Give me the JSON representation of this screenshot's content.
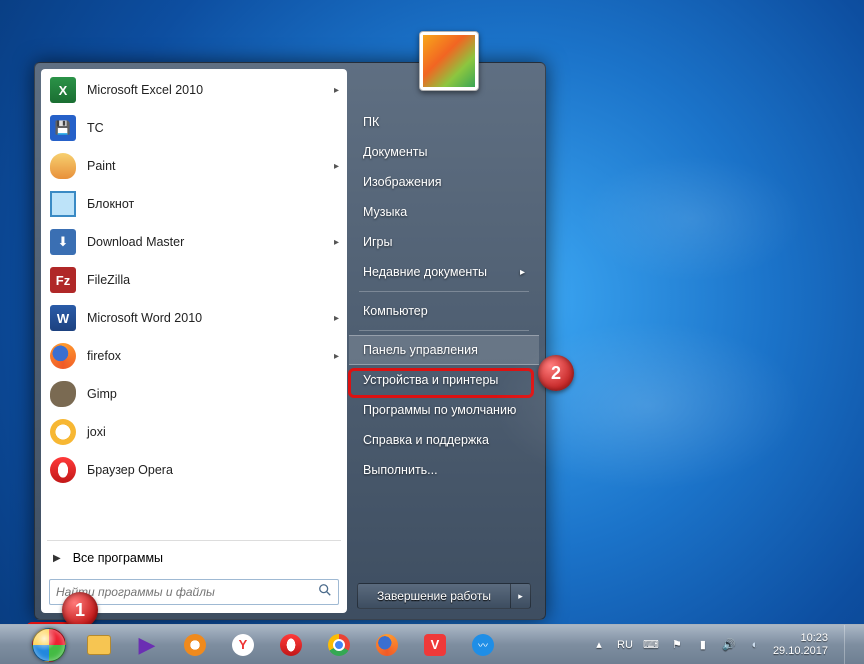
{
  "programs": [
    {
      "label": "Microsoft Excel 2010",
      "icon": "excel-icon",
      "arrow": true
    },
    {
      "label": "TC",
      "icon": "save-icon",
      "arrow": false
    },
    {
      "label": "Paint",
      "icon": "paint-icon",
      "arrow": true
    },
    {
      "label": "Блокнот",
      "icon": "notepad-icon",
      "arrow": false
    },
    {
      "label": "Download Master",
      "icon": "downloadmaster-icon",
      "arrow": true
    },
    {
      "label": "FileZilla",
      "icon": "filezilla-icon",
      "arrow": false
    },
    {
      "label": "Microsoft Word 2010",
      "icon": "word-icon",
      "arrow": true
    },
    {
      "label": "firefox",
      "icon": "firefox-icon",
      "arrow": true
    },
    {
      "label": "Gimp",
      "icon": "gimp-icon",
      "arrow": false
    },
    {
      "label": "joxi",
      "icon": "joxi-icon",
      "arrow": false
    },
    {
      "label": "Браузер Opera",
      "icon": "opera-icon",
      "arrow": false
    }
  ],
  "all_programs_label": "Все программы",
  "search": {
    "placeholder": "Найти программы и файлы"
  },
  "right_panel": {
    "group1": [
      "ПК",
      "Документы",
      "Изображения",
      "Музыка",
      "Игры"
    ],
    "recent": {
      "label": "Недавние документы",
      "arrow": true
    },
    "group2": [
      "Компьютер"
    ],
    "highlighted": "Панель управления",
    "group3": [
      "Устройства и принтеры",
      "Программы по умолчанию",
      "Справка и поддержка",
      "Выполнить..."
    ]
  },
  "shutdown_label": "Завершение работы",
  "taskbar": {
    "apps": [
      {
        "name": "explorer-icon",
        "color": "#f6c552"
      },
      {
        "name": "media-player-icon",
        "color": "#6b2fb3"
      },
      {
        "name": "wmp-icon",
        "color": "#f08a1d"
      },
      {
        "name": "yandex-icon",
        "color": "#ffcc00",
        "text": "Y"
      },
      {
        "name": "opera-icon",
        "color": "#e2231a"
      },
      {
        "name": "chrome-icon",
        "color": "#4285f4"
      },
      {
        "name": "firefox-icon",
        "color": "#ff7a2e"
      },
      {
        "name": "vivaldi-icon",
        "color": "#ef3939",
        "text": "V"
      },
      {
        "name": "maxthon-icon",
        "color": "#1f8ee6"
      }
    ],
    "tray_up": "▴",
    "lang": "RU",
    "time": "10:23",
    "date": "29.10.2017"
  },
  "annotations": {
    "badge1": "1",
    "badge2": "2"
  }
}
